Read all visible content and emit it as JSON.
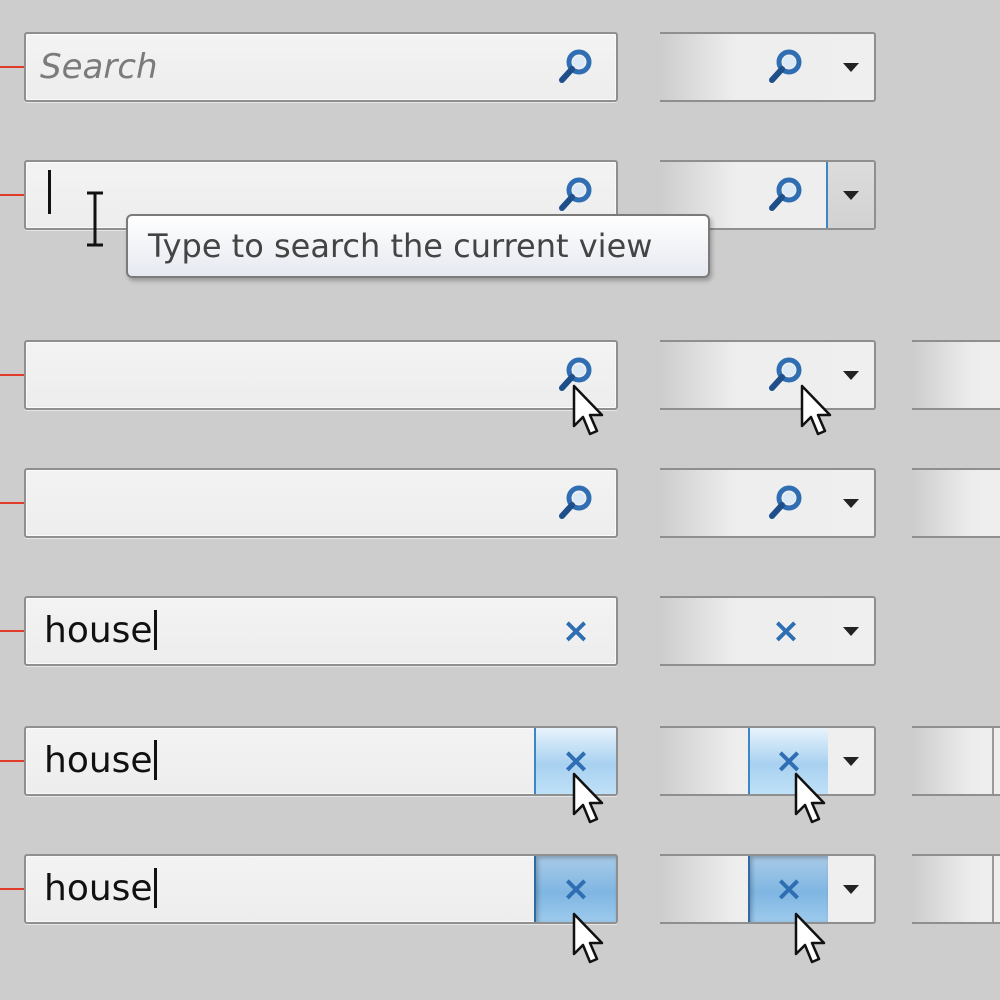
{
  "colors": {
    "accent_red": "#e03a2a",
    "icon_blue": "#2f6eb3",
    "hover_blue": "#a8d1f0",
    "pressed_blue": "#7fb6e2"
  },
  "icons": {
    "search": "magnifier-icon",
    "clear": "clear-x-icon",
    "dropdown": "triangle-down-icon",
    "pointer": "arrow-cursor-icon",
    "text_cursor": "ibeam-cursor-icon"
  },
  "clear_glyph": "×",
  "rows": [
    {
      "state": "empty-placeholder",
      "placeholder": "Search",
      "value": "",
      "icon": "search"
    },
    {
      "state": "focused-empty",
      "placeholder": "",
      "value": "",
      "icon": "search"
    },
    {
      "state": "icon-hover",
      "placeholder": "",
      "value": "",
      "icon": "search"
    },
    {
      "state": "disabled-look",
      "placeholder": "",
      "value": "",
      "icon": "search"
    },
    {
      "state": "has-text",
      "placeholder": "",
      "value": "house",
      "icon": "clear"
    },
    {
      "state": "clear-hover",
      "placeholder": "",
      "value": "house",
      "icon": "clear"
    },
    {
      "state": "clear-pressed",
      "placeholder": "",
      "value": "house",
      "icon": "clear"
    }
  ],
  "tooltip": {
    "text": "Type to search the current view"
  }
}
